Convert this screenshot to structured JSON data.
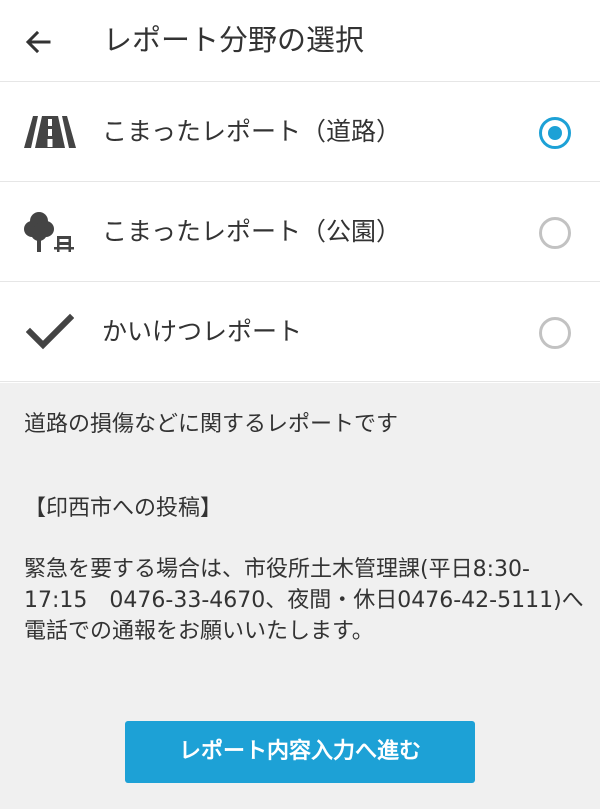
{
  "header": {
    "title": "レポート分野の選択",
    "back_icon": "arrow-left-icon"
  },
  "options": [
    {
      "label": "こまったレポート（道路）",
      "icon": "road-icon",
      "selected": true
    },
    {
      "label": "こまったレポート（公園）",
      "icon": "park-tree-bench-icon",
      "selected": false
    },
    {
      "label": "かいけつレポート",
      "icon": "checkmark-icon",
      "selected": false
    }
  ],
  "description": {
    "summary": "道路の損傷などに関するレポートです",
    "heading": "【印西市への投稿】",
    "body": "緊急を要する場合は、市役所土木管理課(平日8:30-17:15　0476-33-4670、夜間・休日0476-42-5111)へ電話での通報をお願いいたします。"
  },
  "button": {
    "label": "レポート内容入力へ進む"
  },
  "colors": {
    "accent": "#1da1d6",
    "radio_unchecked": "#c2c2c2",
    "text": "#333333",
    "icon": "#444444",
    "panel_background": "#f0f0f0"
  }
}
